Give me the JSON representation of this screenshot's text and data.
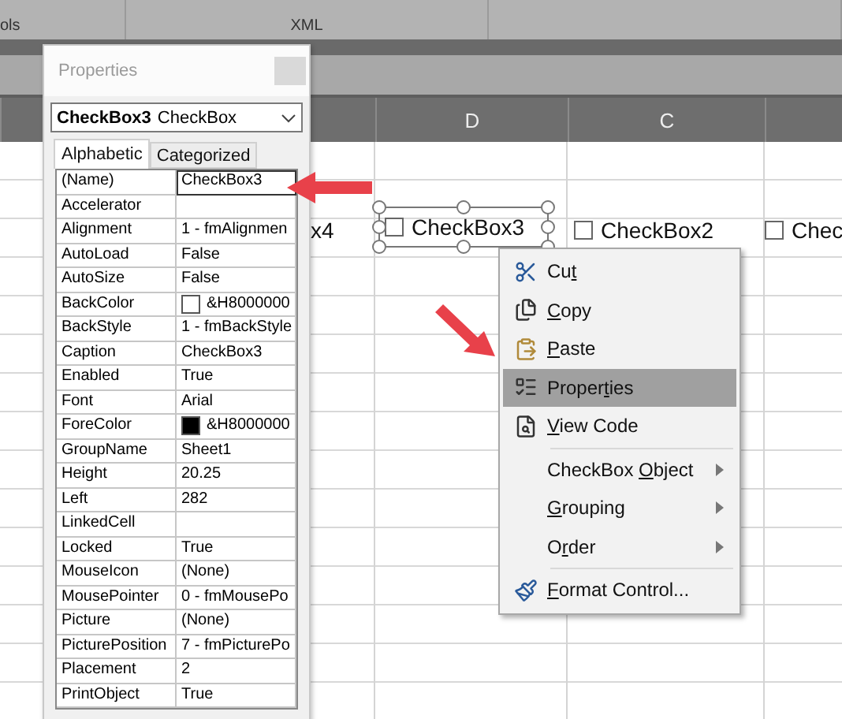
{
  "ribbon": {
    "groups": [
      {
        "label": "ols"
      },
      {
        "label": "XML"
      }
    ]
  },
  "sheet": {
    "columns": [
      "",
      "D",
      "C",
      ""
    ],
    "controls": [
      {
        "kind": "partial",
        "label": "x4",
        "selected": false
      },
      {
        "kind": "checkbox",
        "label": "CheckBox3",
        "selected": true,
        "checked": false
      },
      {
        "kind": "checkbox",
        "label": "CheckBox2",
        "selected": false,
        "checked": false
      },
      {
        "kind": "checkbox",
        "label": "Chec",
        "selected": false,
        "checked": false
      }
    ]
  },
  "properties": {
    "title": "Properties",
    "object_name": "CheckBox3",
    "object_type": "CheckBox",
    "tabs": [
      {
        "label": "Alphabetic",
        "selected": true
      },
      {
        "label": "Categorized",
        "selected": false
      }
    ],
    "rows": [
      {
        "name": "(Name)",
        "value": "CheckBox3",
        "selected": true
      },
      {
        "name": "Accelerator",
        "value": "",
        "selected": false
      },
      {
        "name": "Alignment",
        "value": "1 - fmAlignmen",
        "selected": false
      },
      {
        "name": "AutoLoad",
        "value": "False",
        "selected": false
      },
      {
        "name": "AutoSize",
        "value": "False",
        "selected": false
      },
      {
        "name": "BackColor",
        "value": "&H8000000",
        "selected": false,
        "color": "#ffffff"
      },
      {
        "name": "BackStyle",
        "value": "1 - fmBackStyle",
        "selected": false
      },
      {
        "name": "Caption",
        "value": "CheckBox3",
        "selected": false
      },
      {
        "name": "Enabled",
        "value": "True",
        "selected": false
      },
      {
        "name": "Font",
        "value": "Arial",
        "selected": false
      },
      {
        "name": "ForeColor",
        "value": "&H8000000",
        "selected": false,
        "color": "#000000"
      },
      {
        "name": "GroupName",
        "value": "Sheet1",
        "selected": false
      },
      {
        "name": "Height",
        "value": "20.25",
        "selected": false
      },
      {
        "name": "Left",
        "value": "282",
        "selected": false
      },
      {
        "name": "LinkedCell",
        "value": "",
        "selected": false
      },
      {
        "name": "Locked",
        "value": "True",
        "selected": false
      },
      {
        "name": "MouseIcon",
        "value": "(None)",
        "selected": false
      },
      {
        "name": "MousePointer",
        "value": "0 - fmMousePo",
        "selected": false
      },
      {
        "name": "Picture",
        "value": "(None)",
        "selected": false
      },
      {
        "name": "PicturePosition",
        "value": "7 - fmPicturePo",
        "selected": false
      },
      {
        "name": "Placement",
        "value": "2",
        "selected": false
      },
      {
        "name": "PrintObject",
        "value": "True",
        "selected": false
      }
    ]
  },
  "context_menu": {
    "items": [
      {
        "kind": "command",
        "before": "Cu",
        "key": "t",
        "selected": false,
        "submenu": false
      },
      {
        "kind": "command",
        "key": "C",
        "after": "opy",
        "selected": false,
        "submenu": false
      },
      {
        "kind": "command",
        "key": "P",
        "after": "aste",
        "selected": false,
        "submenu": false
      },
      {
        "kind": "command",
        "before": "Proper",
        "key": "t",
        "after": "ies",
        "selected": true,
        "submenu": false
      },
      {
        "kind": "command",
        "key": "V",
        "after": "iew Code",
        "selected": false,
        "submenu": false
      },
      {
        "kind": "separator"
      },
      {
        "kind": "command",
        "before": "CheckBox ",
        "key": "O",
        "after": "bject",
        "selected": false,
        "submenu": true
      },
      {
        "kind": "command",
        "key": "G",
        "after": "rouping",
        "selected": false,
        "submenu": true
      },
      {
        "kind": "command",
        "before": "O",
        "key": "r",
        "after": "der",
        "selected": false,
        "submenu": true
      },
      {
        "kind": "separator"
      },
      {
        "kind": "command",
        "key": "F",
        "after": "ormat Control...",
        "selected": false,
        "submenu": false
      }
    ]
  }
}
